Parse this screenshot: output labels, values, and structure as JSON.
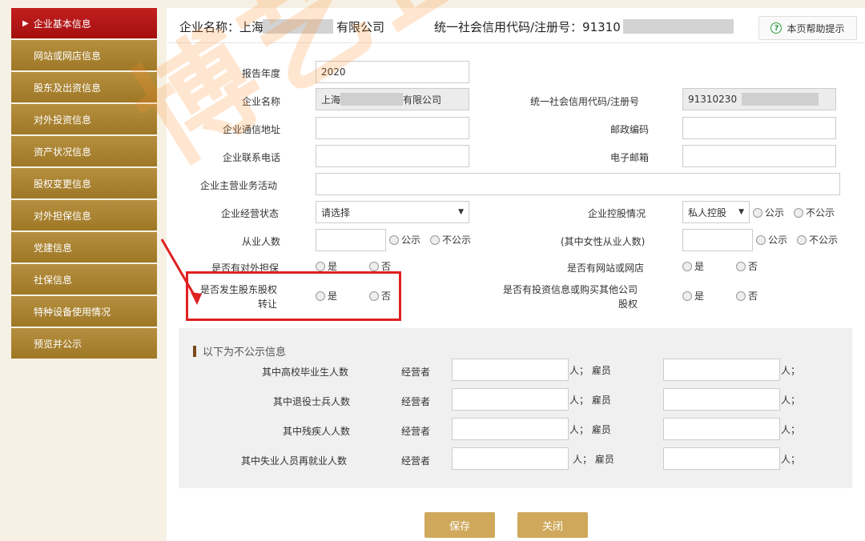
{
  "sidebar": {
    "items": [
      {
        "label": "企业基本信息",
        "active": true
      },
      {
        "label": "网站或网店信息"
      },
      {
        "label": "股东及出资信息"
      },
      {
        "label": "对外投资信息"
      },
      {
        "label": "资产状况信息"
      },
      {
        "label": "股权变更信息"
      },
      {
        "label": "对外担保信息"
      },
      {
        "label": "党建信息"
      },
      {
        "label": "社保信息"
      },
      {
        "label": "特种设备使用情况"
      },
      {
        "label": "预览并公示"
      }
    ]
  },
  "header": {
    "company_label": "企业名称：上海",
    "company_suffix": "有限公司",
    "credit_label": "统一社会信用代码/注册号：91310",
    "help_label": "本页帮助提示"
  },
  "form": {
    "report_year_label": "报告年度",
    "report_year_value": "2020",
    "company_name_label": "企业名称",
    "company_name_prefix": "上海",
    "company_name_suffix": "有限公司",
    "credit_code_label": "统一社会信用代码/注册号",
    "credit_code_value": "91310230",
    "address_label": "企业通信地址",
    "postcode_label": "邮政编码",
    "phone_label": "企业联系电话",
    "email_label": "电子邮箱",
    "business_label": "企业主营业务活动",
    "status_label": "企业经营状态",
    "status_value": "请选择",
    "holding_label": "企业控股情况",
    "holding_value": "私人控股",
    "employees_label": "从业人数",
    "female_label": "(其中女性从业人数)",
    "guarantee_label": "是否有对外担保",
    "website_label": "是否有网站或网店",
    "equity_transfer_label_1": "是否发生股东股权",
    "equity_transfer_label_2": "转让",
    "invest_label_1": "是否有投资信息或购买其他公司",
    "invest_label_2": "股权",
    "opt_public": "公示",
    "opt_private": "不公示",
    "opt_yes": "是",
    "opt_no": "否"
  },
  "private_section": {
    "title": "以下为不公示信息",
    "rows": [
      {
        "label": "其中高校毕业生人数"
      },
      {
        "label": "其中退役士兵人数"
      },
      {
        "label": "其中残疾人人数"
      },
      {
        "label": "其中失业人员再就业人数"
      }
    ],
    "operator_label": "经营者",
    "employee_label": "人； 雇员",
    "unit_label": "人；"
  },
  "buttons": {
    "save": "保存",
    "close": "关闭"
  },
  "watermark": "博艺企业",
  "colors": {
    "accent_red": "#c21f1f",
    "gold": "#cfa85b",
    "sidebar": "#a98230",
    "highlight": "#e02020"
  }
}
